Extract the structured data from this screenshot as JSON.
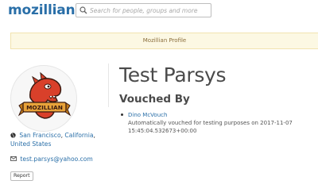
{
  "header": {
    "logo_text": "mozillians",
    "search_placeholder": "Search for people, groups and more",
    "search_icon": "search-icon"
  },
  "banner": {
    "text": "Mozillian Profile"
  },
  "profile": {
    "name": "Test Parsys",
    "avatar_badge_text": "MOZILLIAN",
    "location": {
      "icon": "globe-icon",
      "city": "San Francisco",
      "region": "California",
      "country": "United States"
    },
    "email": {
      "icon": "envelope-icon",
      "address": "test.parsys@yahoo.com"
    },
    "report_label": "Report"
  },
  "vouched": {
    "title": "Vouched By",
    "items": [
      {
        "voucher": "Dino McVouch",
        "description": "Automatically vouched for testing purposes on 2017-11-07 15:45:04.532673+00:00"
      }
    ]
  },
  "colors": {
    "brand": "#2a6fa8",
    "banner_bg": "#fcf8e3",
    "banner_text": "#8a6d3b",
    "mascot_red": "#d9402a",
    "badge_orange": "#e8a33a"
  }
}
